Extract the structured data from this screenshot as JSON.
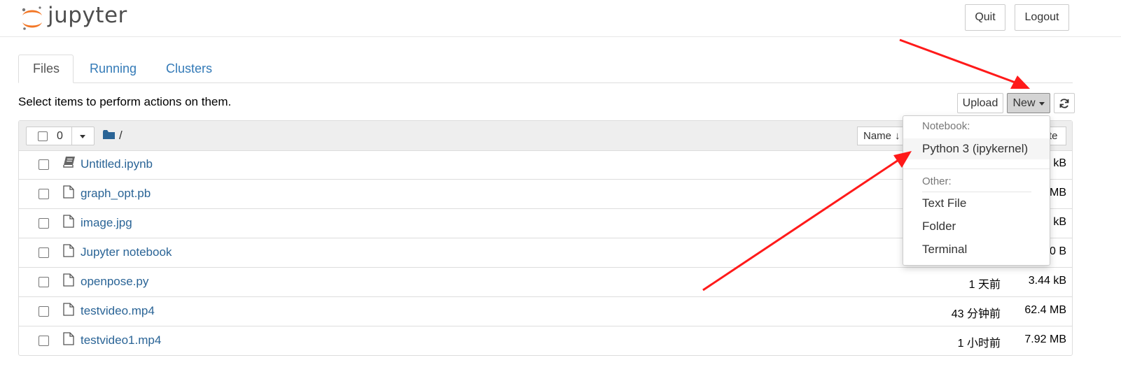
{
  "header": {
    "logo_text": "jupyter",
    "quit_label": "Quit",
    "logout_label": "Logout"
  },
  "tabs": [
    {
      "label": "Files",
      "active": true
    },
    {
      "label": "Running",
      "active": false
    },
    {
      "label": "Clusters",
      "active": false
    }
  ],
  "toolbar": {
    "hint": "Select items to perform actions on them.",
    "upload_label": "Upload",
    "new_label": "New"
  },
  "list_header": {
    "selected_count": "0",
    "path": "/",
    "sort_name_label": "Name",
    "sort_size_label": "te"
  },
  "files": [
    {
      "name": "Untitled.ipynb",
      "modified": "",
      "size": "kB",
      "icon": "notebook-icon"
    },
    {
      "name": "graph_opt.pb",
      "modified": "",
      "size": "MB",
      "icon": "file-icon"
    },
    {
      "name": "image.jpg",
      "modified": "",
      "size": "kB",
      "icon": "file-icon"
    },
    {
      "name": "Jupyter notebook",
      "modified": "",
      "size": "0 B",
      "icon": "file-icon"
    },
    {
      "name": "openpose.py",
      "modified": "1 天前",
      "size": "3.44 kB",
      "icon": "file-icon"
    },
    {
      "name": "testvideo.mp4",
      "modified": "43 分钟前",
      "size": "62.4 MB",
      "icon": "file-icon"
    },
    {
      "name": "testvideo1.mp4",
      "modified": "1 小时前",
      "size": "7.92 MB",
      "icon": "file-icon"
    }
  ],
  "new_menu": {
    "notebook_header": "Notebook:",
    "python_kernel": "Python 3 (ipykernel)",
    "other_header": "Other:",
    "text_file": "Text File",
    "folder": "Folder",
    "terminal": "Terminal"
  },
  "colors": {
    "link": "#2a6496",
    "annotation_arrow": "#ff1a1a",
    "logo_orange": "#f37726"
  }
}
